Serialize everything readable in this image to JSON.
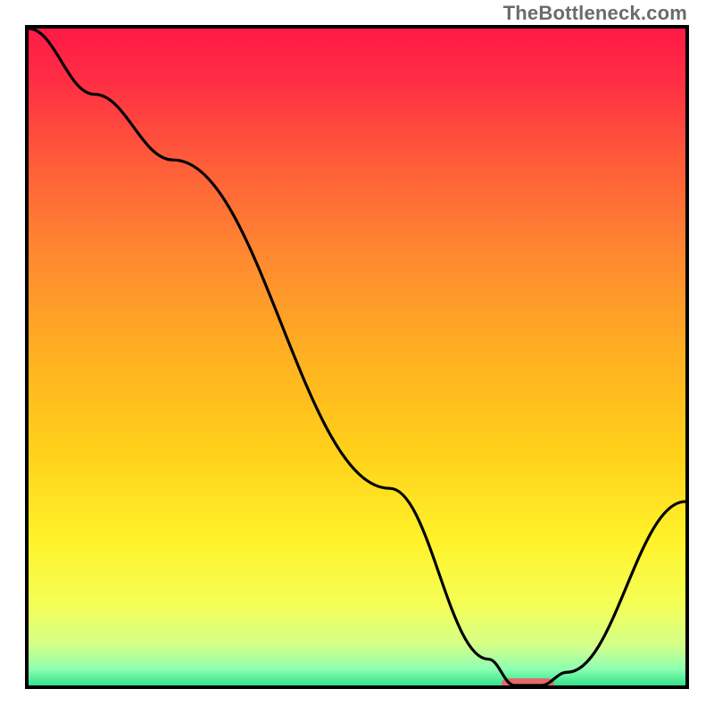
{
  "watermark": "TheBottleneck.com",
  "chart_data": {
    "type": "line",
    "title": "",
    "xlabel": "",
    "ylabel": "",
    "xlim": [
      0,
      100
    ],
    "ylim": [
      0,
      100
    ],
    "series": [
      {
        "name": "bottleneck-curve",
        "x": [
          0,
          10,
          22,
          55,
          70,
          74,
          78,
          82,
          100
        ],
        "values": [
          100,
          90,
          80,
          30,
          4,
          0,
          0,
          2,
          28
        ]
      }
    ],
    "highlight": {
      "x_start": 72,
      "x_end": 80,
      "y": 0
    },
    "background_gradient": {
      "stops": [
        {
          "offset": 0.0,
          "color": "#ff1a46"
        },
        {
          "offset": 0.08,
          "color": "#ff2e44"
        },
        {
          "offset": 0.2,
          "color": "#ff5b3a"
        },
        {
          "offset": 0.35,
          "color": "#ff8a30"
        },
        {
          "offset": 0.5,
          "color": "#ffb121"
        },
        {
          "offset": 0.65,
          "color": "#ffd21a"
        },
        {
          "offset": 0.78,
          "color": "#fff22a"
        },
        {
          "offset": 0.88,
          "color": "#f4ff58"
        },
        {
          "offset": 0.94,
          "color": "#d2ff8a"
        },
        {
          "offset": 0.975,
          "color": "#8dffb2"
        },
        {
          "offset": 1.0,
          "color": "#34e28a"
        }
      ]
    }
  }
}
